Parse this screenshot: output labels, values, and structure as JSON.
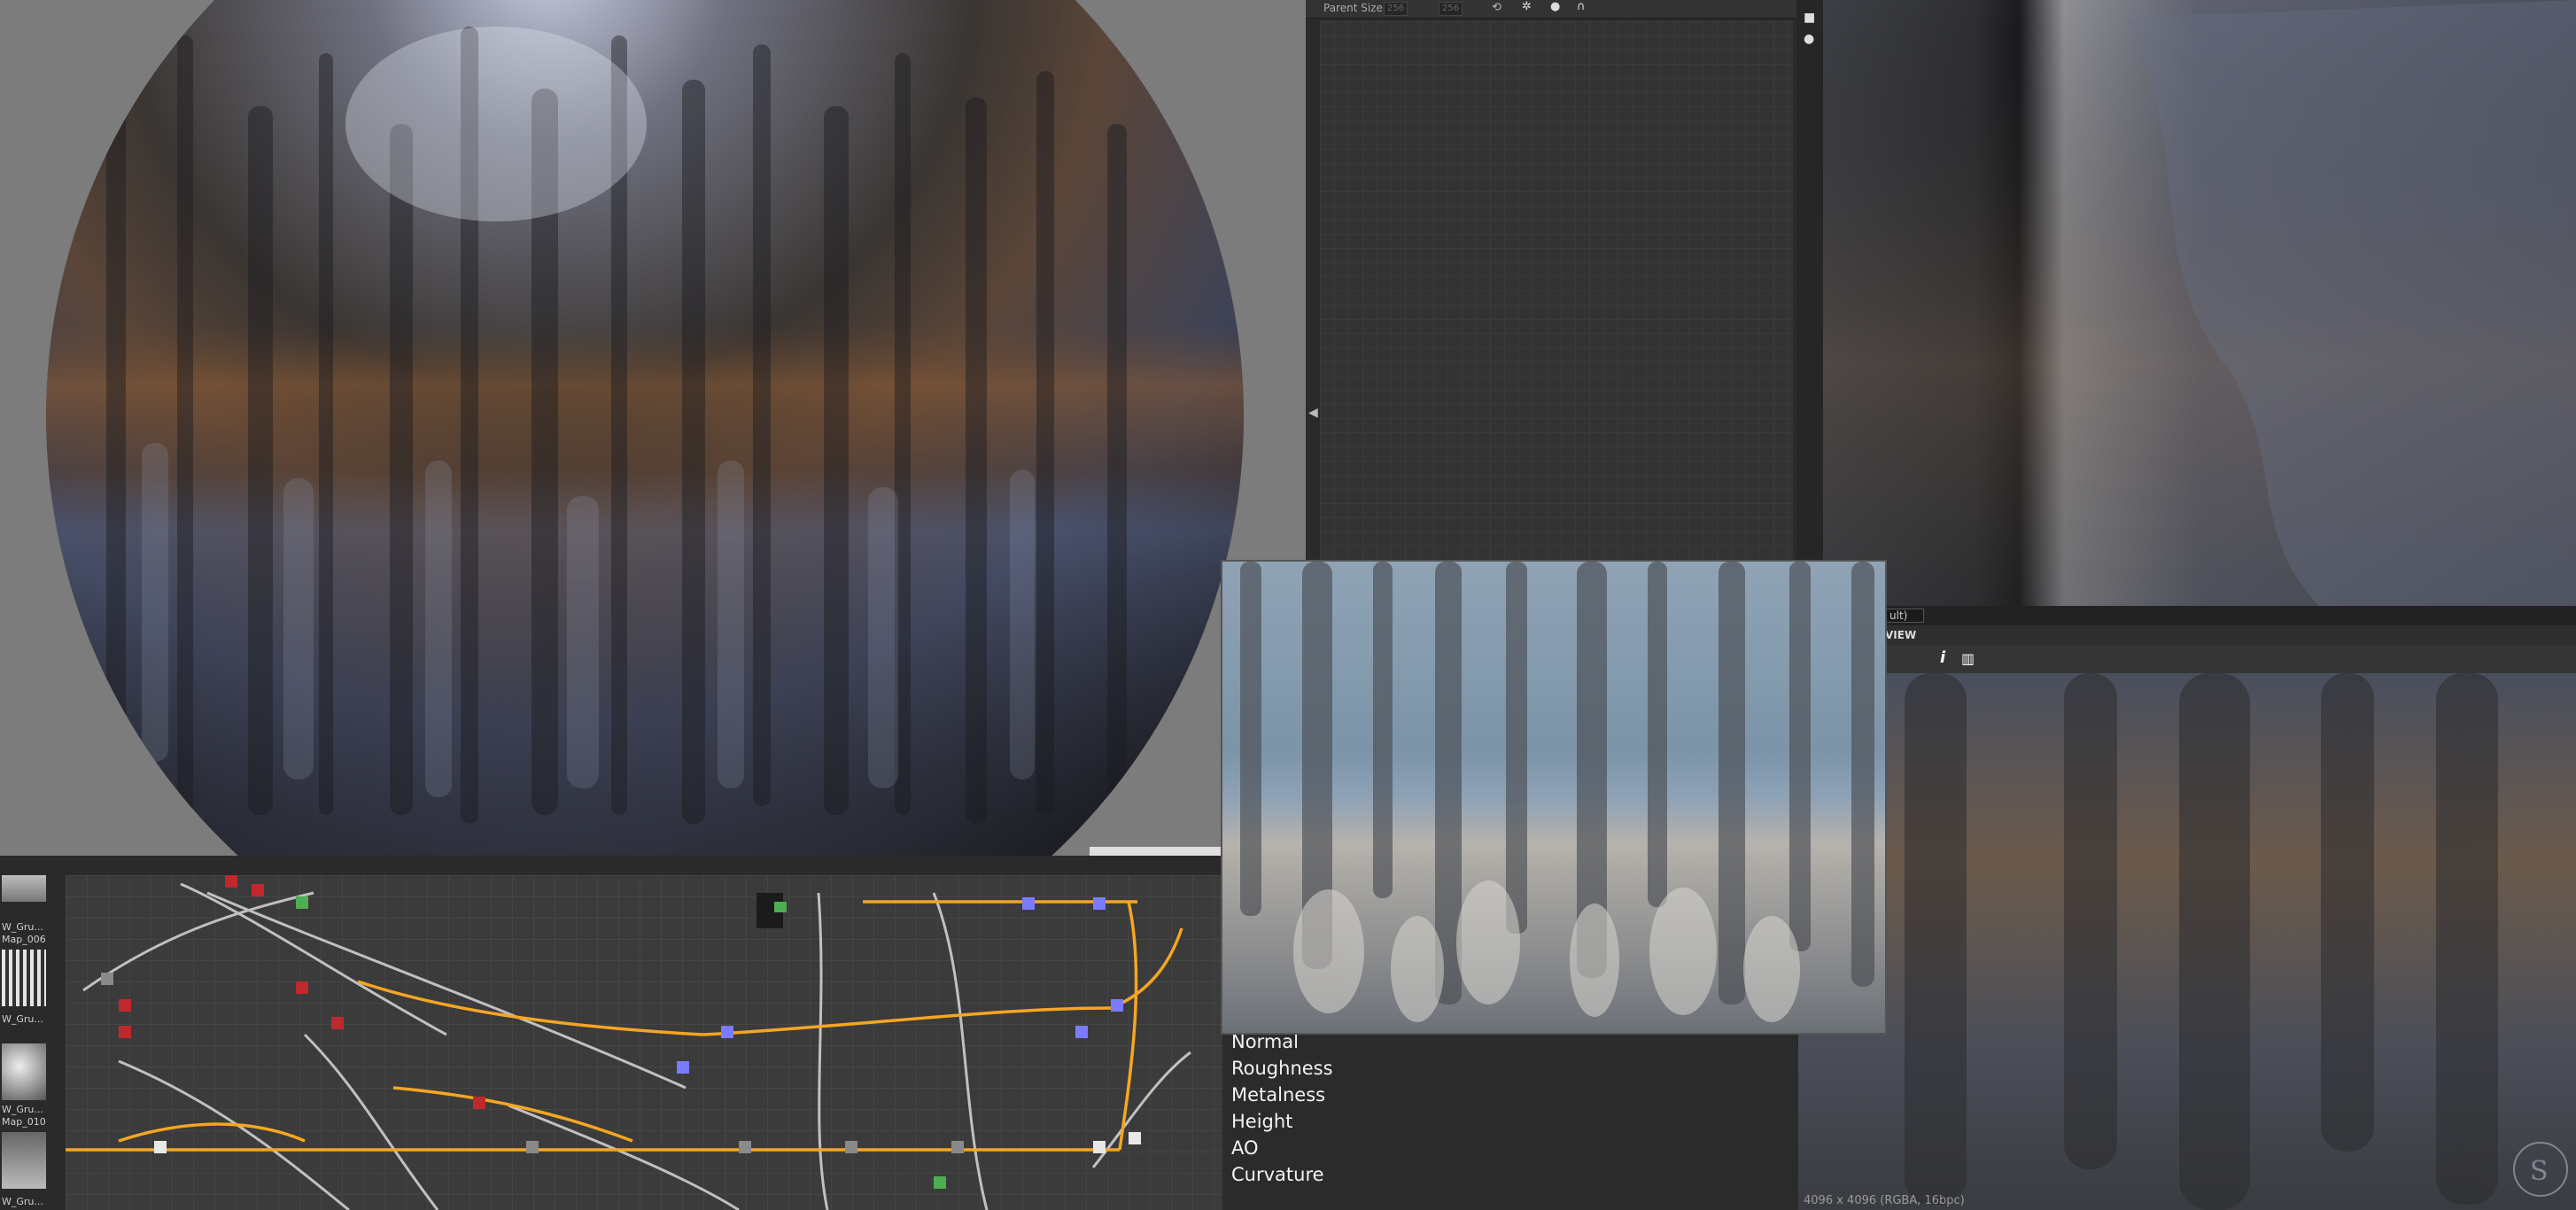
{
  "params_panel": {
    "parent_size_label": "Parent Size:",
    "width_value": "256",
    "height_value": "256"
  },
  "view2d": {
    "mode_selected": "ult)",
    "header_title": "VIEW",
    "info_icon_label": "i",
    "status": "4096 x 4096 (RGBA, 16bpc)"
  },
  "library": {
    "items": [
      {
        "label1": "W_Gru...",
        "label2": "Map_006"
      },
      {
        "label1": "W_Gru..."
      },
      {
        "label1": "W_Gru...",
        "label2": "Map_010"
      },
      {
        "label1": "W_Gru..."
      }
    ]
  },
  "outputs": [
    "Normal",
    "Roughness",
    "Metalness",
    "Height",
    "AO",
    "Curvature"
  ],
  "icons": {
    "camera": "camera-icon",
    "light": "light-icon",
    "histogram": "histogram-icon",
    "logo": "substance-logo-icon"
  },
  "colors": {
    "graph_link_orange": "#f5a623",
    "graph_link_grey": "#c8c8c8",
    "node_red": "#c0282d",
    "node_blue": "#7b7bff",
    "node_green": "#4caf50"
  }
}
